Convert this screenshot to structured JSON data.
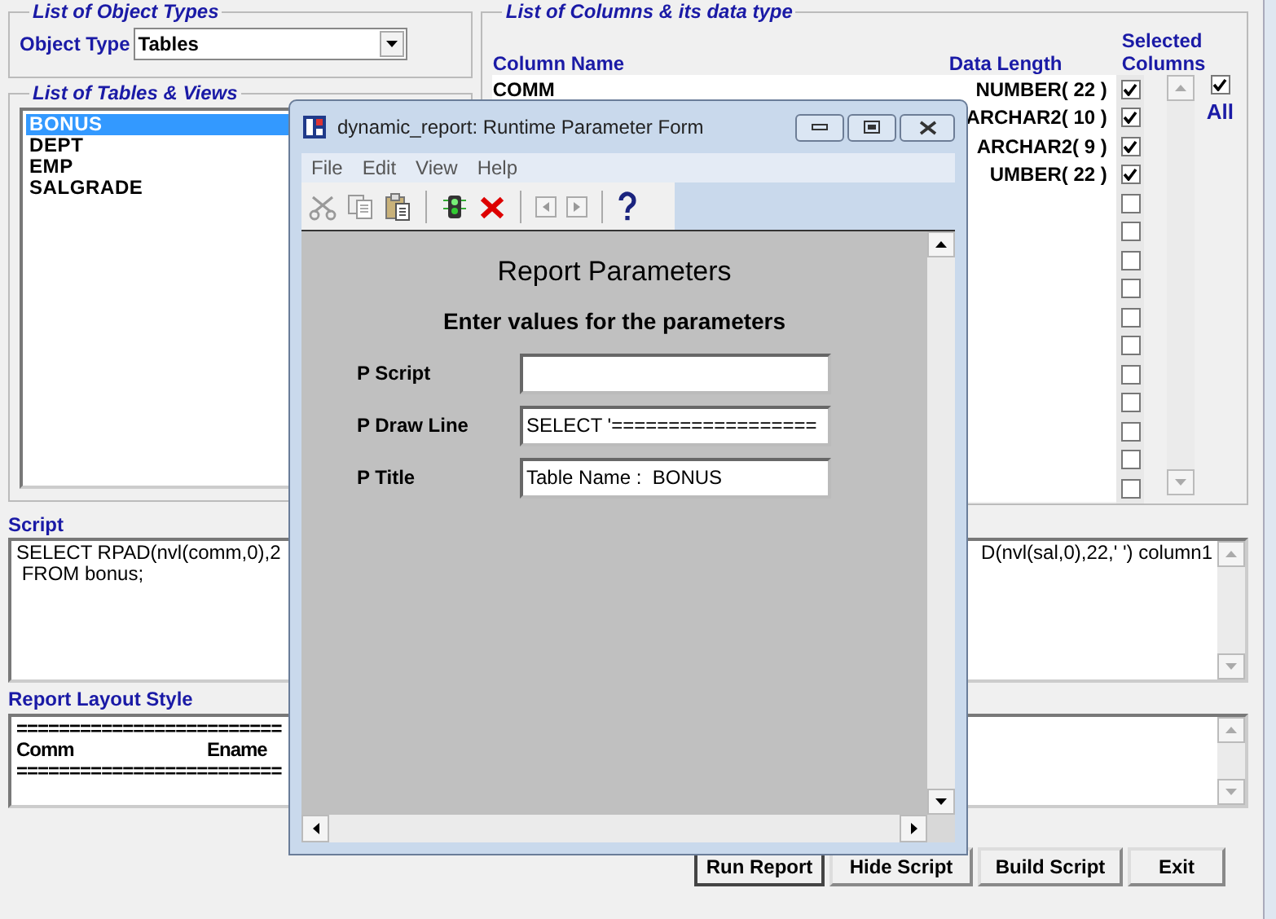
{
  "object_types": {
    "title": "List of Object Types",
    "label": "Object Type",
    "value": "Tables"
  },
  "tables_views": {
    "title": "List of Tables & Views",
    "items": [
      {
        "label": "BONUS",
        "selected": true
      },
      {
        "label": "DEPT",
        "selected": false
      },
      {
        "label": "EMP",
        "selected": false
      },
      {
        "label": "SALGRADE",
        "selected": false
      }
    ]
  },
  "columns": {
    "title": "List of Columns & its data type",
    "column_name_header": "Column Name",
    "data_length_header": "Data Length",
    "selected_header": "Selected Columns",
    "all_label": "All",
    "all_checked": true,
    "rows": [
      {
        "name": "COMM",
        "data_length": "NUMBER( 22 )",
        "checked": true
      },
      {
        "data_length": "ARCHAR2( 10 )",
        "checked": true
      },
      {
        "data_length": "ARCHAR2( 9 )",
        "checked": true
      },
      {
        "data_length": "UMBER( 22 )",
        "checked": true
      },
      {
        "checked": false
      },
      {
        "checked": false
      },
      {
        "checked": false
      },
      {
        "checked": false
      },
      {
        "checked": false
      },
      {
        "checked": false
      },
      {
        "checked": false
      },
      {
        "checked": false
      },
      {
        "checked": false
      },
      {
        "checked": false
      },
      {
        "checked": false
      }
    ]
  },
  "script": {
    "title": "Script",
    "line_1_left": "SELECT RPAD(nvl(comm,0),2",
    "line_1_right": "D(nvl(sal,0),22,' ') column1",
    "line_2": " FROM bonus;"
  },
  "layout_style": {
    "title": "Report Layout Style",
    "rule_1": "=========================",
    "heading_1": "Comm",
    "heading_2": "Ename",
    "rule_2": "========================="
  },
  "buttons": [
    "Run Report",
    "Hide Script",
    "Build Script",
    "Exit"
  ],
  "dialog": {
    "title": "dynamic_report: Runtime Parameter Form",
    "menu": [
      "File",
      "Edit",
      "View",
      "Help"
    ],
    "heading": "Report Parameters",
    "subheading": "Enter values for the parameters",
    "params": [
      {
        "label": "P Script"
      },
      {
        "label": "P Draw Line",
        "value": "SELECT '=================="
      },
      {
        "label": "P Title",
        "value": "Table Name :  BONUS"
      }
    ]
  }
}
